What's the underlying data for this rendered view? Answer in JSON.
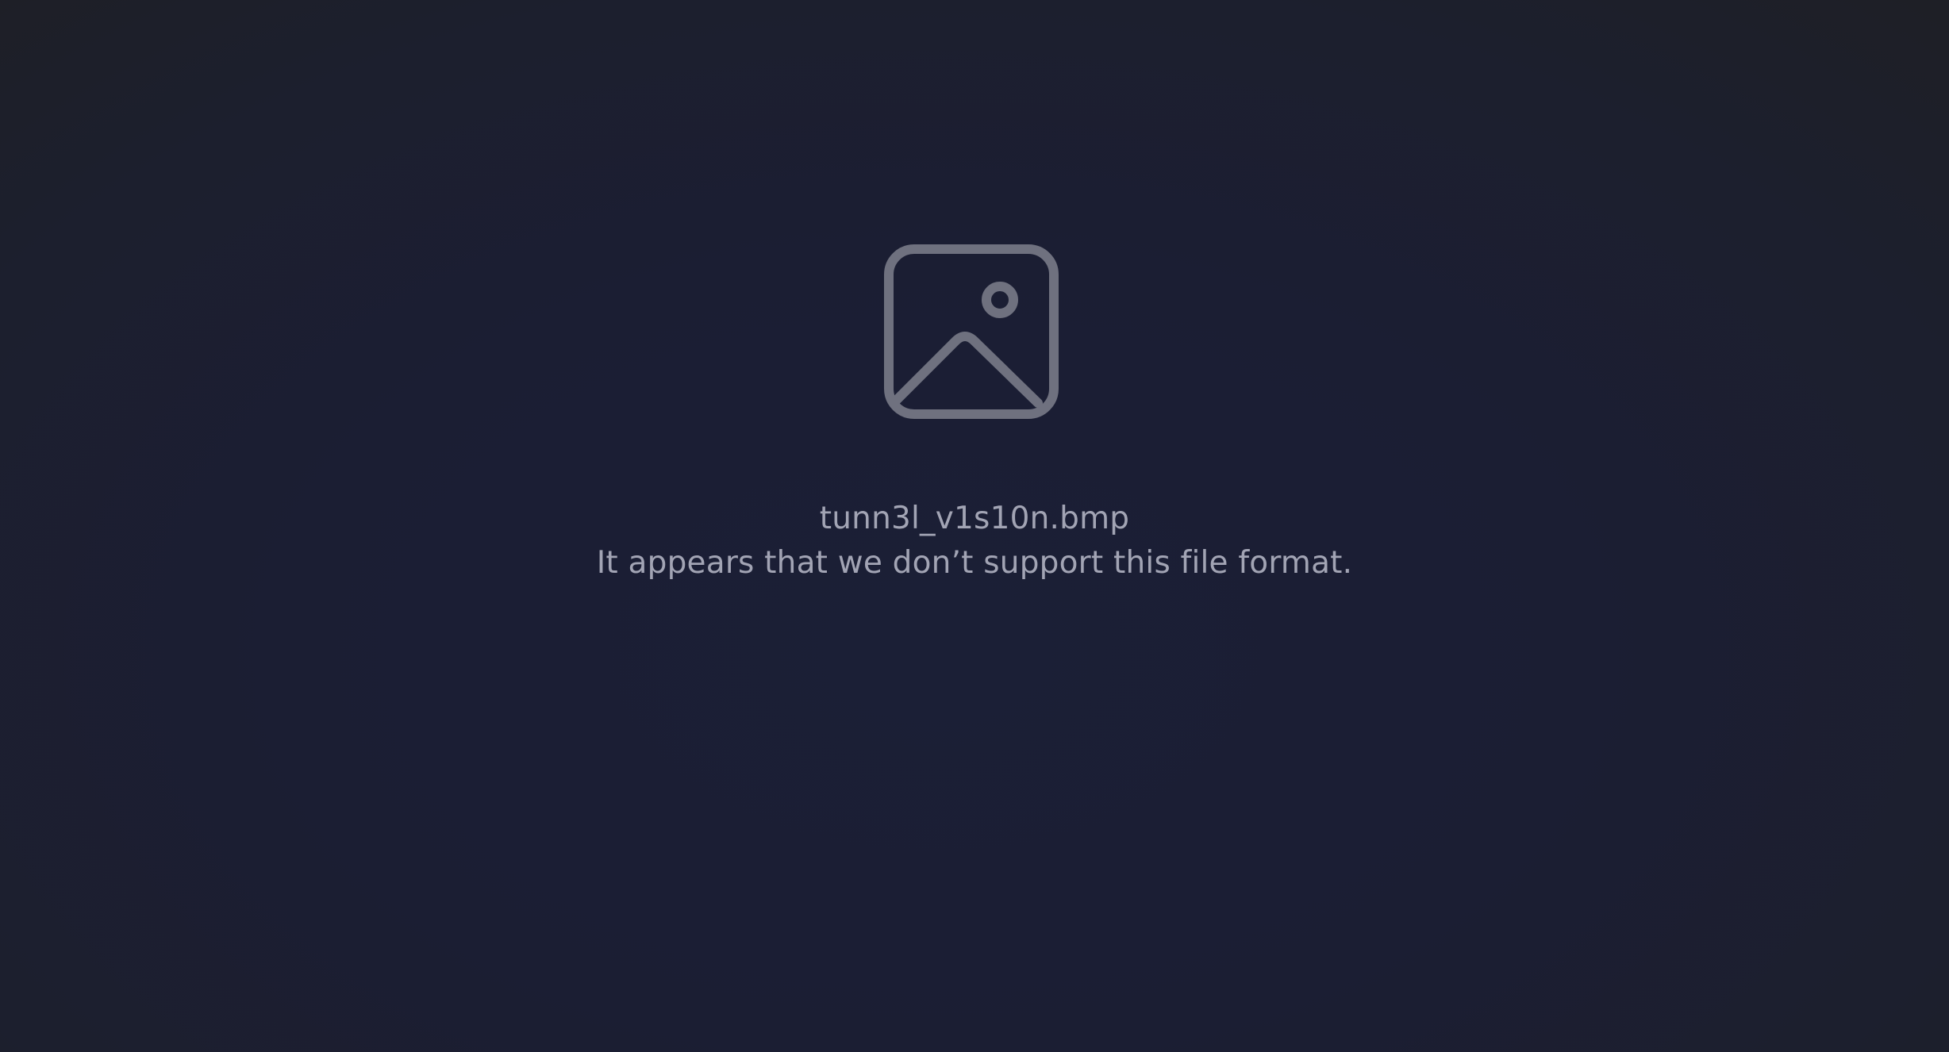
{
  "viewer": {
    "file_name": "tunn3l_v1s10n.bmp",
    "error_message": "It appears that we don’t support this file format.",
    "placeholder_icon": "image-placeholder-icon"
  },
  "colors": {
    "background": "#1b1e33",
    "icon": "#6f717f",
    "text": "#a2a4b4"
  }
}
